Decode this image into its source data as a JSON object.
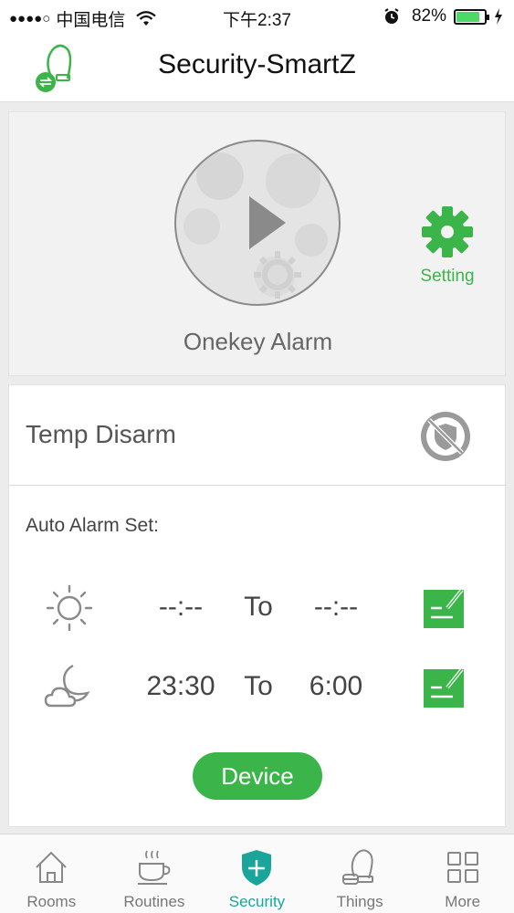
{
  "status_bar": {
    "signal_dots": "●●●●○",
    "carrier": "中国电信",
    "time": "下午2:37",
    "battery": "82%",
    "battery_level": 0.82
  },
  "header": {
    "title": "Security-SmartZ"
  },
  "alarm": {
    "onekey_label": "Onekey Alarm",
    "setting_label": "Setting"
  },
  "disarm": {
    "label": "Temp Disarm"
  },
  "auto_alarm": {
    "title": "Auto Alarm Set:",
    "rows": [
      {
        "icon": "sun-icon",
        "from": "--:--",
        "to_label": "To",
        "to": "--:--"
      },
      {
        "icon": "moon-cloud-icon",
        "from": "23:30",
        "to_label": "To",
        "to": "6:00"
      }
    ],
    "device_button": "Device"
  },
  "tabs": [
    {
      "label": "Rooms",
      "icon": "house-icon"
    },
    {
      "label": "Routines",
      "icon": "coffee-cup-icon"
    },
    {
      "label": "Security",
      "icon": "shield-plus-icon",
      "active": true
    },
    {
      "label": "Things",
      "icon": "vacuum-icon"
    },
    {
      "label": "More",
      "icon": "grid-icon"
    }
  ],
  "colors": {
    "accent_green": "#3bb54a",
    "active_tab": "#1aa59a",
    "grey_icon": "#9a9a9a"
  }
}
